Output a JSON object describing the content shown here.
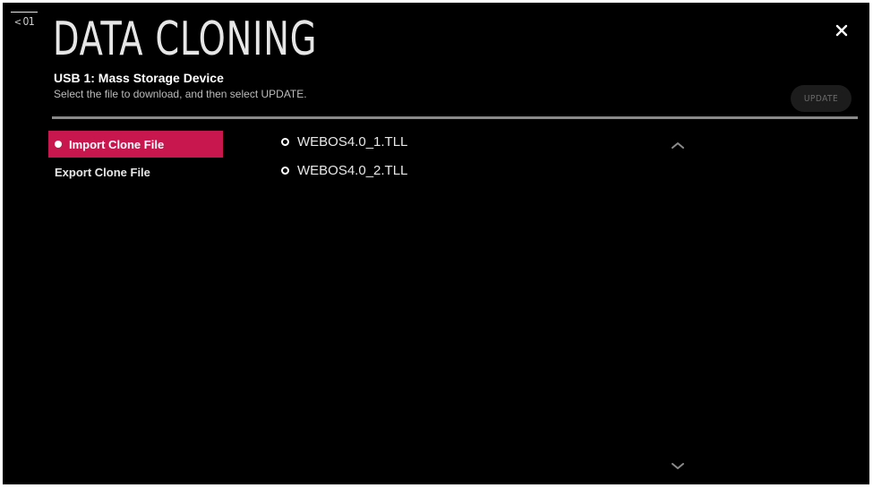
{
  "header": {
    "back_label": "01",
    "title": "DATA CLONING",
    "device": "USB 1: Mass Storage Device",
    "instruction": "Select the file to download, and then select UPDATE.",
    "update_label": "UPDATE"
  },
  "menu": {
    "items": [
      {
        "label": "Import Clone File",
        "selected": true
      },
      {
        "label": "Export Clone File",
        "selected": false
      }
    ]
  },
  "files": {
    "items": [
      {
        "name": "WEBOS4.0_1.TLL"
      },
      {
        "name": "WEBOS4.0_2.TLL"
      }
    ]
  },
  "colors": {
    "accent": "#c8174f",
    "background": "#000000",
    "text": "#ffffff",
    "divider": "#8a8a8a"
  },
  "icons": {
    "back": "chevron-left-icon",
    "close": "close-icon",
    "scroll_up": "chevron-up-icon",
    "scroll_down": "chevron-down-icon"
  }
}
